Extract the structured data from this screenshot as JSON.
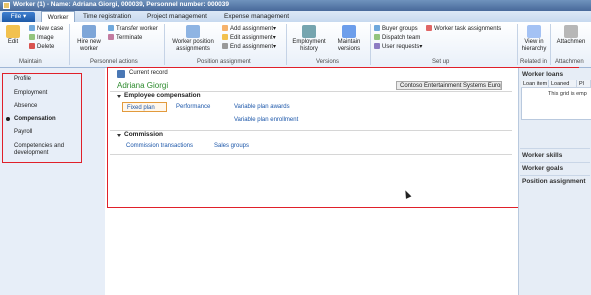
{
  "window": {
    "title": "Worker (1) - Name: Adriana Giorgi, 000039, Personnel number: 000039"
  },
  "tabs": [
    {
      "label": "File"
    },
    {
      "label": "Worker"
    },
    {
      "label": "Time registration"
    },
    {
      "label": "Project management"
    },
    {
      "label": "Expense management"
    }
  ],
  "ribbon": {
    "edit": "Edit",
    "new_case": "New case",
    "image": "Image",
    "delete": "Delete",
    "hire_new": "Hire new",
    "worker": "worker",
    "transfer_worker": "Transfer worker",
    "terminate": "Terminate",
    "worker_position": "Worker position",
    "assignments": "assignments",
    "add_assignment": "Add assignment",
    "edit_assignment": "Edit assignment",
    "end_assignment": "End assignment",
    "employment": "Employment",
    "history": "history",
    "maintain": "Maintain",
    "versions": "versions",
    "buyer_groups": "Buyer groups",
    "dispatch_team": "Dispatch team",
    "user_requests": "User requests",
    "worker_task_assignments": "Worker task assignments",
    "view_in": "View in",
    "hierarchy": "hierarchy",
    "attachments": "Attachmen",
    "groups": {
      "maintain": "Maintain",
      "personnel_actions": "Personnel actions",
      "position_assignment": "Position assignment",
      "versions": "Versions",
      "set_up": "Set up",
      "related_in": "Related in",
      "attachments": "Attachmen"
    }
  },
  "nav": {
    "items": [
      "Profile",
      "Employment",
      "Absence",
      "Compensation",
      "Payroll",
      "Competencies and",
      "development"
    ]
  },
  "main": {
    "current_record": "Current record",
    "worker_name": "Adriana Giorgi",
    "company": "Contoso Entertainment Systems Europe",
    "section1": {
      "title": "Employee compensation",
      "links": [
        "Fixed plan",
        "Performance",
        "Variable plan awards",
        "Variable plan enrollment"
      ]
    },
    "section2": {
      "title": "Commission",
      "links": [
        "Commission transactions",
        "Sales groups"
      ]
    }
  },
  "factbox": {
    "loans_title": "Worker loans",
    "columns": [
      "Loan item",
      "Loaned",
      "Pl"
    ],
    "empty": "This grid is emp",
    "skills": "Worker skills",
    "goals": "Worker goals",
    "position": "Position assignment"
  },
  "colors": {
    "highlight_red": "#e0202a",
    "worker_name_green": "#2e8b2e",
    "link_blue": "#1b56a9"
  }
}
